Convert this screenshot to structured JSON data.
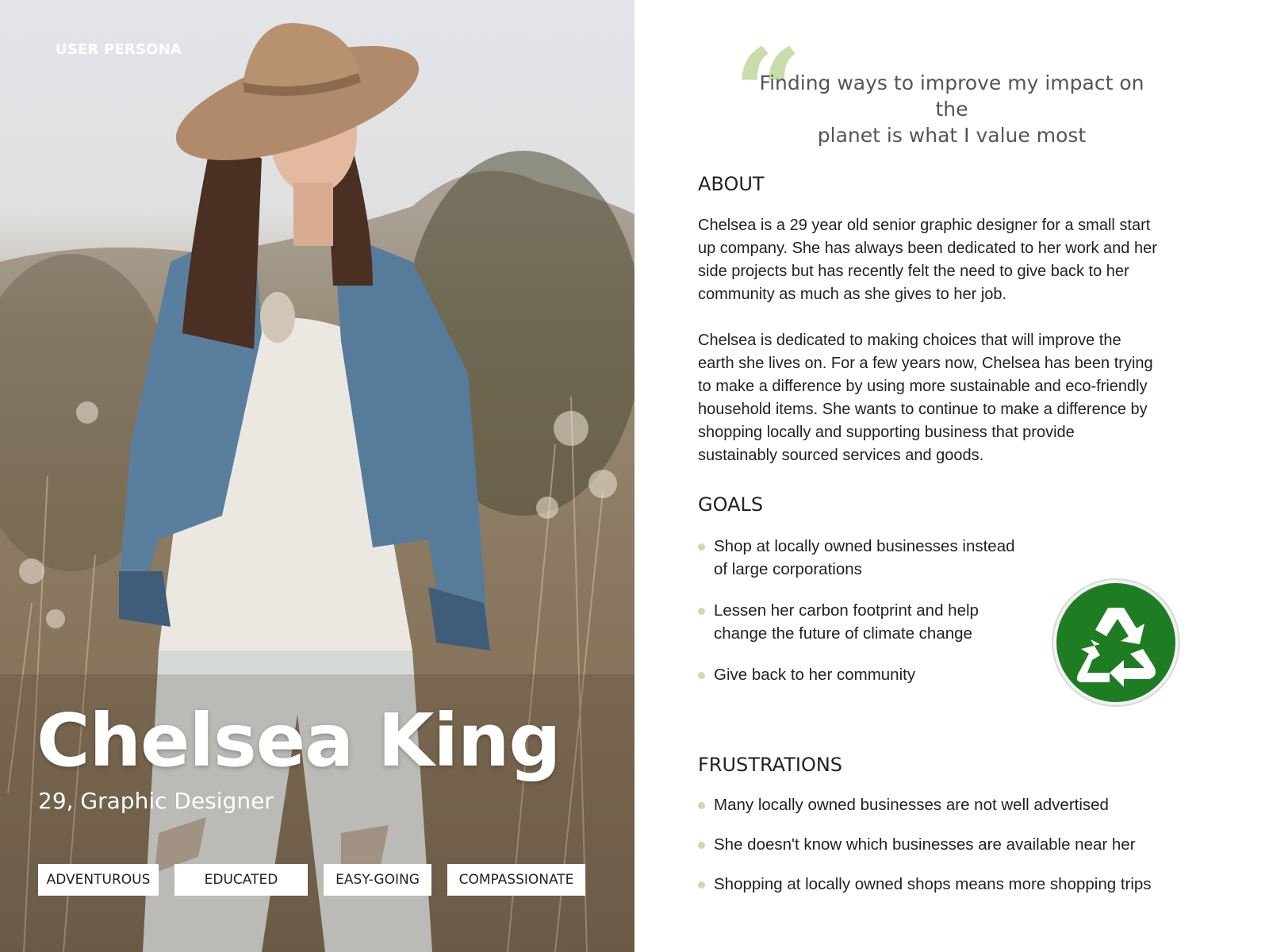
{
  "photo_panel": {
    "label": "USER PERSONA",
    "name": "Chelsea King",
    "role": "29, Graphic Designer",
    "traits": [
      "ADVENTUROUS",
      "EDUCATED",
      "EASY-GOING",
      "COMPASSIONATE"
    ]
  },
  "quote": {
    "line1": "Finding ways to improve my impact on the",
    "line2": "planet is what I value most"
  },
  "about": {
    "title": "ABOUT",
    "para1": [
      "Chelsea is a 29 year old senior graphic designer for a small start",
      "up company. She has always been dedicated to her work and her",
      "side projects but has recently felt the need to give back to her",
      "community as much as she gives to her job."
    ],
    "para2": [
      "Chelsea is dedicated to making choices that will improve the",
      "earth she lives on. For a few years now, Chelsea has been trying",
      "to make a difference by using more sustainable and eco-friendly",
      "household items. She wants to continue to make a difference by",
      "shopping locally and supporting business that provide",
      "sustainably sourced services and goods."
    ]
  },
  "goals": {
    "title": "GOALS",
    "items": [
      [
        "Shop at locally owned businesses instead",
        "of large corporations"
      ],
      [
        "Lessen her carbon footprint and help",
        "change the future of climate change"
      ],
      [
        "Give back to her community"
      ]
    ]
  },
  "frustrations": {
    "title": "FRUSTRATIONS",
    "items": [
      "Many locally owned businesses are not well advertised",
      "She doesn't know which businesses are available near her",
      "Shopping at locally owned shops means more shopping trips"
    ]
  },
  "colors": {
    "accent_green": "#c9dcab",
    "recycle_green": "#1e7d22"
  },
  "icons": {
    "quote": "quote-mark-icon",
    "recycle": "recycle-icon"
  }
}
